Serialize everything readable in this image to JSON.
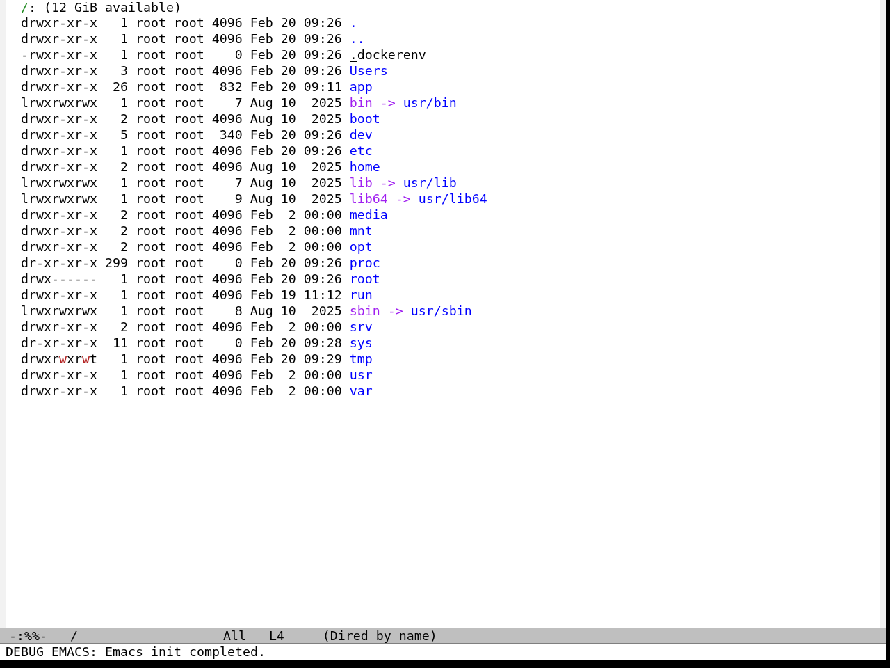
{
  "header": {
    "directory": "/",
    "info": ": (12 GiB available)"
  },
  "entries": [
    {
      "permissions": "drwxr-xr-x",
      "links": "1",
      "owner": "root",
      "group": "root",
      "size": "4096",
      "date": "Feb 20 09:26",
      "name": ".",
      "kind": "directory",
      "cursor": false,
      "write_highlight": false
    },
    {
      "permissions": "drwxr-xr-x",
      "links": "1",
      "owner": "root",
      "group": "root",
      "size": "4096",
      "date": "Feb 20 09:26",
      "name": "..",
      "kind": "directory",
      "cursor": false,
      "write_highlight": false
    },
    {
      "permissions": "-rwxr-xr-x",
      "links": "1",
      "owner": "root",
      "group": "root",
      "size": "0",
      "date": "Feb 20 09:26",
      "name": ".dockerenv",
      "kind": "file",
      "cursor": true,
      "write_highlight": false
    },
    {
      "permissions": "drwxr-xr-x",
      "links": "3",
      "owner": "root",
      "group": "root",
      "size": "4096",
      "date": "Feb 20 09:26",
      "name": "Users",
      "kind": "directory",
      "cursor": false,
      "write_highlight": false
    },
    {
      "permissions": "drwxr-xr-x",
      "links": "26",
      "owner": "root",
      "group": "root",
      "size": "832",
      "date": "Feb 20 09:11",
      "name": "app",
      "kind": "directory",
      "cursor": false,
      "write_highlight": false
    },
    {
      "permissions": "lrwxrwxrwx",
      "links": "1",
      "owner": "root",
      "group": "root",
      "size": "7",
      "date": "Aug 10  2025",
      "name": "bin",
      "kind": "symlink",
      "arrow": "->",
      "target": "usr/bin",
      "cursor": false,
      "write_highlight": false
    },
    {
      "permissions": "drwxr-xr-x",
      "links": "2",
      "owner": "root",
      "group": "root",
      "size": "4096",
      "date": "Aug 10  2025",
      "name": "boot",
      "kind": "directory",
      "cursor": false,
      "write_highlight": false
    },
    {
      "permissions": "drwxr-xr-x",
      "links": "5",
      "owner": "root",
      "group": "root",
      "size": "340",
      "date": "Feb 20 09:26",
      "name": "dev",
      "kind": "directory",
      "cursor": false,
      "write_highlight": false
    },
    {
      "permissions": "drwxr-xr-x",
      "links": "1",
      "owner": "root",
      "group": "root",
      "size": "4096",
      "date": "Feb 20 09:26",
      "name": "etc",
      "kind": "directory",
      "cursor": false,
      "write_highlight": false
    },
    {
      "permissions": "drwxr-xr-x",
      "links": "2",
      "owner": "root",
      "group": "root",
      "size": "4096",
      "date": "Aug 10  2025",
      "name": "home",
      "kind": "directory",
      "cursor": false,
      "write_highlight": false
    },
    {
      "permissions": "lrwxrwxrwx",
      "links": "1",
      "owner": "root",
      "group": "root",
      "size": "7",
      "date": "Aug 10  2025",
      "name": "lib",
      "kind": "symlink",
      "arrow": "->",
      "target": "usr/lib",
      "cursor": false,
      "write_highlight": false
    },
    {
      "permissions": "lrwxrwxrwx",
      "links": "1",
      "owner": "root",
      "group": "root",
      "size": "9",
      "date": "Aug 10  2025",
      "name": "lib64",
      "kind": "symlink",
      "arrow": "->",
      "target": "usr/lib64",
      "cursor": false,
      "write_highlight": false
    },
    {
      "permissions": "drwxr-xr-x",
      "links": "2",
      "owner": "root",
      "group": "root",
      "size": "4096",
      "date": "Feb  2 00:00",
      "name": "media",
      "kind": "directory",
      "cursor": false,
      "write_highlight": false
    },
    {
      "permissions": "drwxr-xr-x",
      "links": "2",
      "owner": "root",
      "group": "root",
      "size": "4096",
      "date": "Feb  2 00:00",
      "name": "mnt",
      "kind": "directory",
      "cursor": false,
      "write_highlight": false
    },
    {
      "permissions": "drwxr-xr-x",
      "links": "2",
      "owner": "root",
      "group": "root",
      "size": "4096",
      "date": "Feb  2 00:00",
      "name": "opt",
      "kind": "directory",
      "cursor": false,
      "write_highlight": false
    },
    {
      "permissions": "dr-xr-xr-x",
      "links": "299",
      "owner": "root",
      "group": "root",
      "size": "0",
      "date": "Feb 20 09:26",
      "name": "proc",
      "kind": "directory",
      "cursor": false,
      "write_highlight": false
    },
    {
      "permissions": "drwx------",
      "links": "1",
      "owner": "root",
      "group": "root",
      "size": "4096",
      "date": "Feb 20 09:26",
      "name": "root",
      "kind": "directory",
      "cursor": false,
      "write_highlight": false
    },
    {
      "permissions": "drwxr-xr-x",
      "links": "1",
      "owner": "root",
      "group": "root",
      "size": "4096",
      "date": "Feb 19 11:12",
      "name": "run",
      "kind": "directory",
      "cursor": false,
      "write_highlight": false
    },
    {
      "permissions": "lrwxrwxrwx",
      "links": "1",
      "owner": "root",
      "group": "root",
      "size": "8",
      "date": "Aug 10  2025",
      "name": "sbin",
      "kind": "symlink",
      "arrow": "->",
      "target": "usr/sbin",
      "cursor": false,
      "write_highlight": false
    },
    {
      "permissions": "drwxr-xr-x",
      "links": "2",
      "owner": "root",
      "group": "root",
      "size": "4096",
      "date": "Feb  2 00:00",
      "name": "srv",
      "kind": "directory",
      "cursor": false,
      "write_highlight": false
    },
    {
      "permissions": "dr-xr-xr-x",
      "links": "11",
      "owner": "root",
      "group": "root",
      "size": "0",
      "date": "Feb 20 09:28",
      "name": "sys",
      "kind": "directory",
      "cursor": false,
      "write_highlight": false
    },
    {
      "permissions": "drwxrwxrwt",
      "links": "1",
      "owner": "root",
      "group": "root",
      "size": "4096",
      "date": "Feb 20 09:29",
      "name": "tmp",
      "kind": "directory",
      "cursor": false,
      "write_highlight": true
    },
    {
      "permissions": "drwxr-xr-x",
      "links": "1",
      "owner": "root",
      "group": "root",
      "size": "4096",
      "date": "Feb  2 00:00",
      "name": "usr",
      "kind": "directory",
      "cursor": false,
      "write_highlight": false
    },
    {
      "permissions": "drwxr-xr-x",
      "links": "1",
      "owner": "root",
      "group": "root",
      "size": "4096",
      "date": "Feb  2 00:00",
      "name": "var",
      "kind": "directory",
      "cursor": false,
      "write_highlight": false
    }
  ],
  "mode_line": {
    "status": "-:%%-",
    "buffer": "/",
    "position": "All",
    "line": "L4",
    "mode": "(Dired by name)"
  },
  "echo_area": {
    "message": "DEBUG EMACS: Emacs init completed."
  }
}
